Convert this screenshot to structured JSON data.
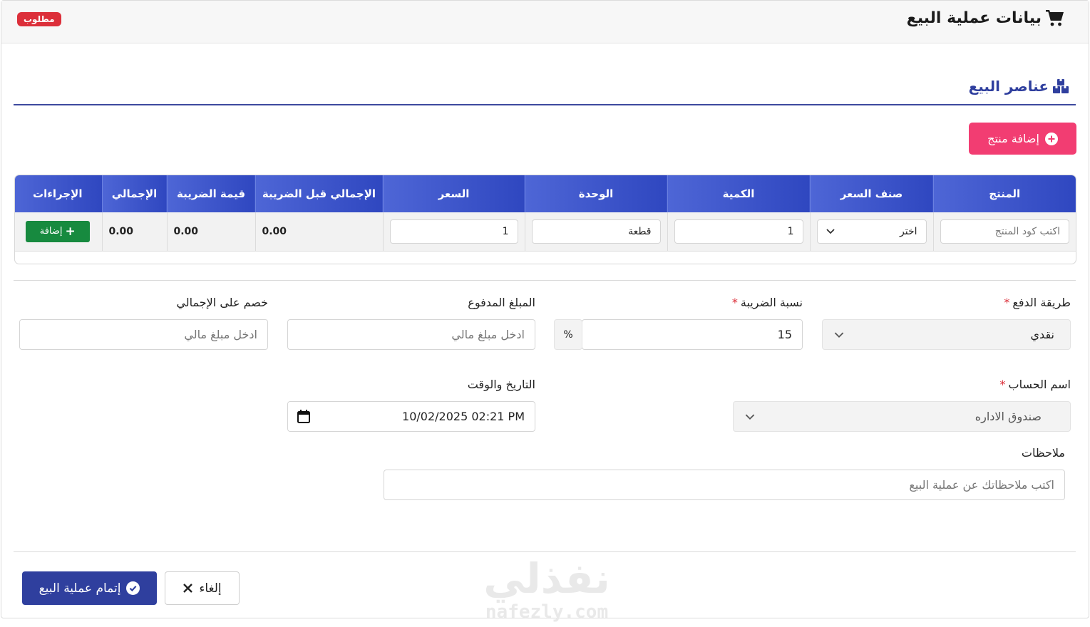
{
  "header": {
    "title": "بيانات عملية البيع",
    "required_badge": "مطلوب",
    "title_icon": "cart-icon"
  },
  "section": {
    "title": "عناصر البيع",
    "icon": "boxes-icon"
  },
  "add_product_button": "إضافة منتج",
  "table": {
    "columns": [
      "المنتج",
      "صنف السعر",
      "الكمية",
      "الوحدة",
      "السعر",
      "الإجمالي قبل الضريبة",
      "قيمة الضريبة",
      "الإجمالي",
      "الإجراءات"
    ],
    "row": {
      "product_placeholder": "اكتب كود المنتج",
      "price_type": "اختر",
      "quantity": "1",
      "unit": "قطعة",
      "price": "1",
      "subtotal": "0.00",
      "tax_value": "0.00",
      "total": "0.00",
      "add_button": "إضافة"
    }
  },
  "form": {
    "payment_method": {
      "label": "طريقة الدفع",
      "value": "نقدي"
    },
    "tax_rate": {
      "label": "نسبة الضريبة",
      "value": "15",
      "suffix": "%"
    },
    "paid_amount": {
      "label": "المبلغ المدفوع",
      "placeholder": "ادخل مبلغ مالي"
    },
    "discount": {
      "label": "خصم على الإجمالي",
      "placeholder": "ادخل مبلغ مالي"
    },
    "account_name": {
      "label": "اسم الحساب",
      "value": "صندوق الاداره"
    },
    "datetime": {
      "label": "التاريخ والوقت",
      "value": "10/02/2025 02:21 PM"
    },
    "notes": {
      "label": "ملاحظات",
      "placeholder": "اكتب ملاحظاتك عن عملية البيع"
    }
  },
  "footer": {
    "submit_label": "إتمام عملية البيع",
    "cancel_label": "إلغاء"
  },
  "watermark": {
    "arabic": "نفذلي",
    "latin": "nafezly.com"
  },
  "colors": {
    "primary": "#2f3f9e",
    "pink": "#f23d72",
    "green": "#178a3f",
    "red": "#dc2f3a"
  }
}
